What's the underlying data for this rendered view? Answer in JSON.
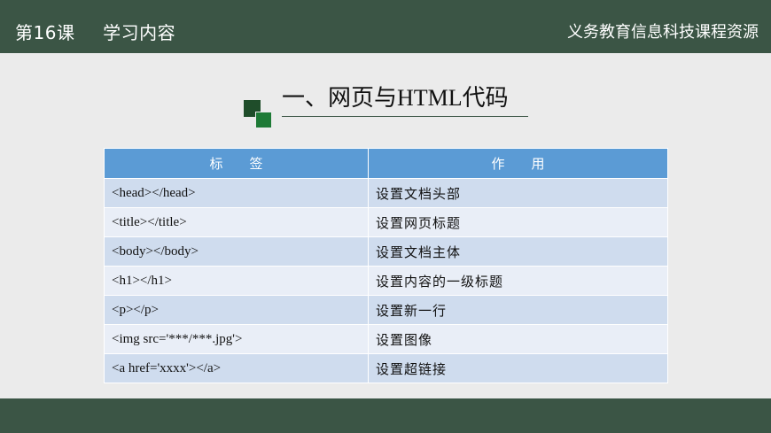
{
  "header": {
    "lesson_number": "第16课",
    "lesson_title": "学习内容",
    "resource": "义务教育信息科技课程资源"
  },
  "slide": {
    "title": "一、网页与HTML代码"
  },
  "table": {
    "headers": [
      "标　　签",
      "作　　用"
    ],
    "rows": [
      {
        "tag": "<head></head>",
        "use": "设置文档头部"
      },
      {
        "tag": "<title></title>",
        "use": "设置网页标题"
      },
      {
        "tag": "<body></body>",
        "use": "设置文档主体"
      },
      {
        "tag": "<h1></h1>",
        "use": "设置内容的一级标题"
      },
      {
        "tag": "<p></p>",
        "use": "设置新一行"
      },
      {
        "tag": "<img src='***/***.jpg'>",
        "use": "设置图像"
      },
      {
        "tag": "<a href='xxxx'></a>",
        "use": "设置超链接"
      }
    ]
  },
  "colors": {
    "bar": "#3b5545",
    "header_fill": "#5b9bd5",
    "row_dark": "#cfdcee",
    "row_light": "#e9eef7"
  }
}
